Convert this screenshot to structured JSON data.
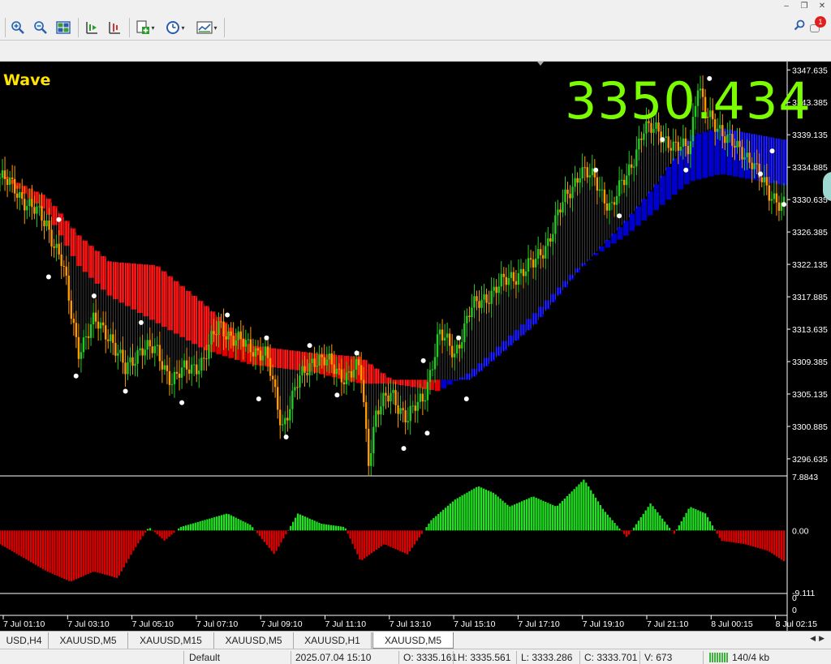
{
  "window_buttons": [
    "–",
    "❐",
    "✕"
  ],
  "toolbar_icons": [
    "zoom-in-icon",
    "zoom-out-icon",
    "tile-windows-icon",
    "chart-shift-icon",
    "autoscroll-icon",
    "indicators-icon",
    "periods-icon",
    "templates-icon",
    "search-icon",
    "notifications-icon"
  ],
  "notifications_count": "1",
  "indicator_name": "Wave",
  "bid_price_display": "3350.434",
  "chart_data": {
    "type": "candlestick",
    "symbol": "XAUUSD",
    "timeframe": "M5",
    "price_axis": {
      "ticks": [
        "3347.635",
        "3343.385",
        "3339.135",
        "3334.885",
        "3330.635",
        "3326.385",
        "3322.135",
        "3317.885",
        "3313.635",
        "3309.385",
        "3305.135",
        "3300.885",
        "3296.635"
      ],
      "ylim": [
        3294.5,
        3348.3
      ]
    },
    "oscillator_axis": {
      "ticks": [
        "7.8843",
        "0.00",
        "-9.111"
      ],
      "ylim": [
        -9.111,
        7.8843
      ]
    },
    "volume_axis": {
      "ticks": [
        "0",
        "0"
      ]
    },
    "time_axis": {
      "ticks": [
        "7 Jul 01:10",
        "7 Jul 03:10",
        "7 Jul 05:10",
        "7 Jul 07:10",
        "7 Jul 09:10",
        "7 Jul 11:10",
        "7 Jul 13:10",
        "7 Jul 15:10",
        "7 Jul 17:10",
        "7 Jul 19:10",
        "7 Jul 21:10",
        "8 Jul 00:15",
        "8 Jul 02:15"
      ]
    },
    "price_path": [
      [
        0,
        3333.5
      ],
      [
        0.02,
        3332.0
      ],
      [
        0.04,
        3329.5
      ],
      [
        0.06,
        3327.5
      ],
      [
        0.08,
        3322.0
      ],
      [
        0.09,
        3316.0
      ],
      [
        0.1,
        3311.0
      ],
      [
        0.12,
        3314.5
      ],
      [
        0.14,
        3313.0
      ],
      [
        0.16,
        3308.0
      ],
      [
        0.18,
        3311.5
      ],
      [
        0.2,
        3310.5
      ],
      [
        0.22,
        3307.0
      ],
      [
        0.24,
        3308.5
      ],
      [
        0.26,
        3309.5
      ],
      [
        0.28,
        3314.5
      ],
      [
        0.3,
        3312.0
      ],
      [
        0.32,
        3311.5
      ],
      [
        0.34,
        3310.0
      ],
      [
        0.36,
        3301.0
      ],
      [
        0.38,
        3306.5
      ],
      [
        0.4,
        3310.0
      ],
      [
        0.42,
        3309.0
      ],
      [
        0.44,
        3307.5
      ],
      [
        0.46,
        3308.5
      ],
      [
        0.47,
        3296.5
      ],
      [
        0.48,
        3303.0
      ],
      [
        0.5,
        3305.0
      ],
      [
        0.52,
        3302.0
      ],
      [
        0.54,
        3304.5
      ],
      [
        0.56,
        3313.0
      ],
      [
        0.58,
        3310.5
      ],
      [
        0.6,
        3316.0
      ],
      [
        0.62,
        3318.0
      ],
      [
        0.64,
        3319.5
      ],
      [
        0.66,
        3321.0
      ],
      [
        0.68,
        3322.0
      ],
      [
        0.7,
        3325.5
      ],
      [
        0.72,
        3330.5
      ],
      [
        0.74,
        3334.5
      ],
      [
        0.76,
        3333.0
      ],
      [
        0.78,
        3329.5
      ],
      [
        0.8,
        3334.0
      ],
      [
        0.82,
        3339.5
      ],
      [
        0.84,
        3340.0
      ],
      [
        0.86,
        3337.0
      ],
      [
        0.88,
        3338.0
      ],
      [
        0.89,
        3346.0
      ],
      [
        0.9,
        3341.5
      ],
      [
        0.92,
        3340.0
      ],
      [
        0.94,
        3337.0
      ],
      [
        0.96,
        3336.0
      ],
      [
        0.98,
        3331.0
      ],
      [
        1.0,
        3330.5
      ]
    ],
    "cloud_upper": [
      [
        0.0,
        3334.0
      ],
      [
        0.06,
        3331.0
      ],
      [
        0.1,
        3326.0
      ],
      [
        0.14,
        3322.5
      ],
      [
        0.2,
        3322.0
      ],
      [
        0.26,
        3317.0
      ],
      [
        0.32,
        3311.5
      ],
      [
        0.4,
        3310.5
      ],
      [
        0.46,
        3310.0
      ],
      [
        0.5,
        3307.0
      ],
      [
        0.56,
        3307.0
      ],
      [
        0.6,
        3307.0
      ],
      [
        0.68,
        3314.0
      ],
      [
        0.74,
        3321.5
      ],
      [
        0.8,
        3328.0
      ],
      [
        0.84,
        3333.0
      ],
      [
        0.88,
        3339.0
      ],
      [
        0.92,
        3340.0
      ],
      [
        1.0,
        3338.5
      ]
    ],
    "cloud_lower": [
      [
        0.0,
        3334.0
      ],
      [
        0.06,
        3329.0
      ],
      [
        0.1,
        3322.0
      ],
      [
        0.14,
        3318.0
      ],
      [
        0.2,
        3314.5
      ],
      [
        0.26,
        3311.0
      ],
      [
        0.32,
        3309.0
      ],
      [
        0.4,
        3308.0
      ],
      [
        0.46,
        3306.5
      ],
      [
        0.5,
        3306.5
      ],
      [
        0.56,
        3305.5
      ],
      [
        0.6,
        3308.0
      ],
      [
        0.68,
        3315.5
      ],
      [
        0.74,
        3322.0
      ],
      [
        0.8,
        3326.0
      ],
      [
        0.84,
        3329.5
      ],
      [
        0.88,
        3333.0
      ],
      [
        0.92,
        3334.0
      ],
      [
        1.0,
        3332.5
      ]
    ],
    "swing_dots": [
      [
        0.075,
        3328.0
      ],
      [
        0.062,
        3320.5
      ],
      [
        0.097,
        3307.5
      ],
      [
        0.12,
        3318.0
      ],
      [
        0.16,
        3305.5
      ],
      [
        0.18,
        3314.5
      ],
      [
        0.232,
        3304.0
      ],
      [
        0.29,
        3315.5
      ],
      [
        0.33,
        3304.5
      ],
      [
        0.34,
        3312.5
      ],
      [
        0.365,
        3299.5
      ],
      [
        0.395,
        3311.5
      ],
      [
        0.43,
        3305.0
      ],
      [
        0.455,
        3310.5
      ],
      [
        0.515,
        3298.0
      ],
      [
        0.54,
        3309.5
      ],
      [
        0.545,
        3300.0
      ],
      [
        0.585,
        3312.5
      ],
      [
        0.595,
        3304.5
      ],
      [
        0.76,
        3334.5
      ],
      [
        0.79,
        3328.5
      ],
      [
        0.845,
        3338.5
      ],
      [
        0.875,
        3334.5
      ],
      [
        0.905,
        3346.5
      ],
      [
        0.97,
        3334.0
      ],
      [
        0.985,
        3337.0
      ],
      [
        1.0,
        3330.0
      ]
    ],
    "oscillator": [
      [
        0.0,
        -2.0
      ],
      [
        0.03,
        -4.0
      ],
      [
        0.06,
        -6.0
      ],
      [
        0.09,
        -7.5
      ],
      [
        0.12,
        -6.0
      ],
      [
        0.15,
        -7.0
      ],
      [
        0.17,
        -3.0
      ],
      [
        0.19,
        0.5
      ],
      [
        0.21,
        -1.5
      ],
      [
        0.23,
        0.5
      ],
      [
        0.26,
        1.5
      ],
      [
        0.29,
        2.5
      ],
      [
        0.32,
        0.8
      ],
      [
        0.35,
        -3.5
      ],
      [
        0.38,
        2.5
      ],
      [
        0.41,
        1.0
      ],
      [
        0.44,
        0.5
      ],
      [
        0.46,
        -4.5
      ],
      [
        0.49,
        -2.0
      ],
      [
        0.52,
        -3.5
      ],
      [
        0.55,
        1.5
      ],
      [
        0.58,
        4.5
      ],
      [
        0.61,
        6.5
      ],
      [
        0.63,
        5.5
      ],
      [
        0.65,
        3.5
      ],
      [
        0.68,
        5.0
      ],
      [
        0.71,
        3.5
      ],
      [
        0.745,
        7.5
      ],
      [
        0.77,
        3.0
      ],
      [
        0.8,
        -1.0
      ],
      [
        0.83,
        4.0
      ],
      [
        0.86,
        -0.5
      ],
      [
        0.88,
        3.5
      ],
      [
        0.9,
        2.5
      ],
      [
        0.92,
        -1.5
      ],
      [
        0.95,
        -2.0
      ],
      [
        0.98,
        -3.0
      ],
      [
        1.0,
        -4.5
      ]
    ]
  },
  "tabs": [
    "USD,H4",
    "XAUUSD,M5",
    "XAUUSD,M15",
    "XAUUSD,M5",
    "XAUUSD,H1",
    "XAUUSD,M5"
  ],
  "active_tab": 5,
  "status": {
    "profile": "Default",
    "datetime": "2025.07.04 15:10",
    "open": "O: 3335.161",
    "high": "H: 3335.561",
    "low": "L: 3333.286",
    "close": "C: 3333.701",
    "volume": "V: 673",
    "traffic": "140/4 kb"
  },
  "colors": {
    "background": "#000000",
    "bull_candle": "#22cc22",
    "bear_candle": "#ff9900",
    "cloud_bear": "#e00000",
    "cloud_bull": "#0000cc",
    "osc_positive": "#22e022",
    "osc_negative": "#e00000",
    "price_big": "#7cfc00",
    "indicator_name": "#ffe400",
    "axis_text": "#ffffff"
  }
}
